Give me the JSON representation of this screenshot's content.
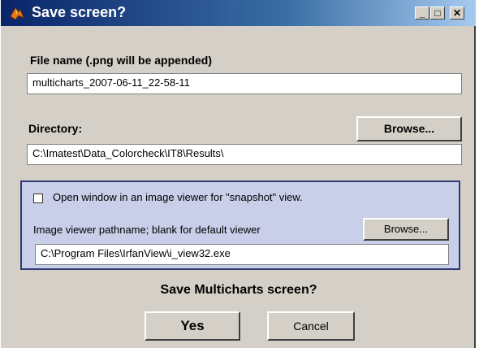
{
  "window": {
    "title": "Save screen?",
    "controls": {
      "minimize": "_",
      "maximize": "□",
      "close": "✕"
    }
  },
  "file_name": {
    "label": "File name (.png will be appended)",
    "value": "multicharts_2007-06-11_22-58-11"
  },
  "directory": {
    "label": "Directory:",
    "browse_label": "Browse...",
    "value": "C:\\Imatest\\Data_Colorcheck\\IT8\\Results\\"
  },
  "viewer_panel": {
    "checkbox_label": "Open window in an image viewer for \"snapshot\" view.",
    "checkbox_checked": false,
    "pathname_label": "Image viewer pathname; blank for default viewer",
    "browse_label": "Browse...",
    "pathname_value": "C:\\Program Files\\IrfanView\\i_view32.exe"
  },
  "prompt": "Save Multicharts screen?",
  "buttons": {
    "yes": "Yes",
    "cancel": "Cancel"
  },
  "colors": {
    "title_start": "#0a246a",
    "title_end": "#a6caf0",
    "panel_bg": "#c9cfe8",
    "dialog_bg": "#d4d0c8"
  }
}
